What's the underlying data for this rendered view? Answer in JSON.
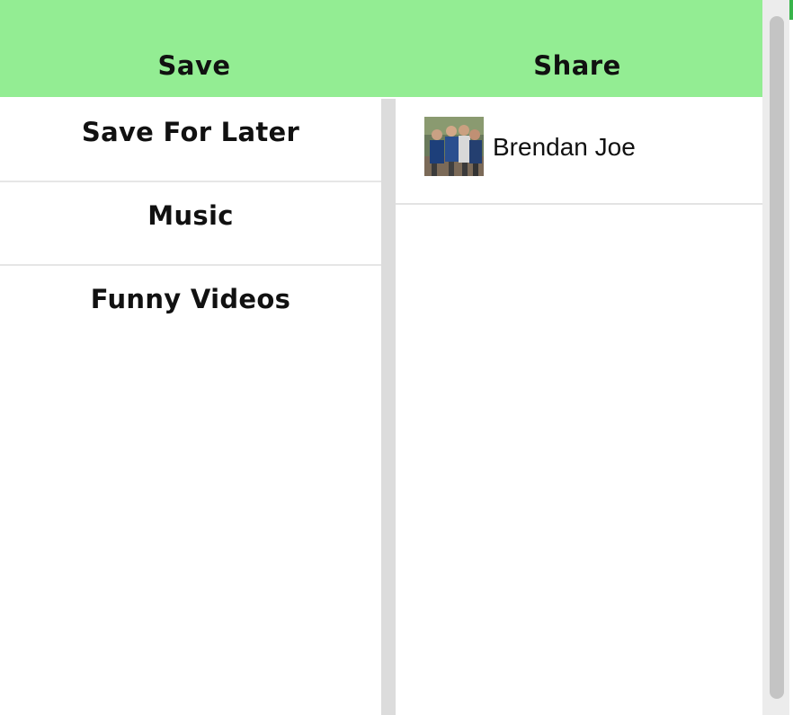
{
  "header": {
    "tabs": [
      {
        "label": "Save"
      },
      {
        "label": "Share"
      }
    ]
  },
  "save_panel": {
    "items": [
      {
        "label": "Save For Later"
      },
      {
        "label": "Music"
      },
      {
        "label": "Funny Videos"
      }
    ]
  },
  "share_panel": {
    "contacts": [
      {
        "name": "Brendan Joe",
        "avatar": "group-photo-avatar"
      }
    ]
  },
  "colors": {
    "header_bg": "#93ed93",
    "divider": "#dcdcdc",
    "scrollbar_thumb": "#c4c4c4"
  }
}
